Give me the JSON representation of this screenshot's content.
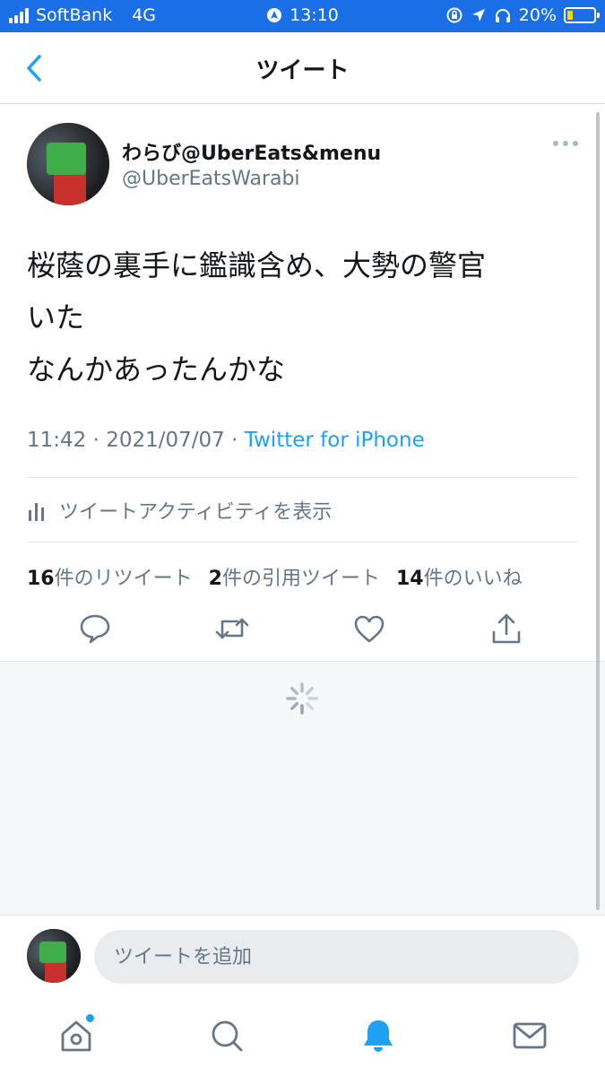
{
  "status_bar": {
    "carrier": "SoftBank",
    "network": "4G",
    "time": "13:10",
    "battery_percent": "20%",
    "battery_level": 0.2
  },
  "header": {
    "title": "ツイート",
    "back_icon": "chevron-left-icon"
  },
  "tweet": {
    "display_name": "わらび@UberEats&menu",
    "handle": "@UberEatsWarabi",
    "text": "桜蔭の裏手に鑑識含め、大勢の警官\nいた\nなんかあったんかな",
    "time": "11:42",
    "date": "2021/07/07",
    "separator": "·",
    "source": "Twitter for iPhone",
    "activity_label": "ツイートアクティビティを表示",
    "stats": {
      "retweets_count": "16",
      "retweets_label": "件のリツイート",
      "quotes_count": "2",
      "quotes_label": "件の引用ツイート",
      "likes_count": "14",
      "likes_label": "件のいいね"
    }
  },
  "compose": {
    "placeholder": "ツイートを追加"
  },
  "colors": {
    "status_bar": "#1a6ee6",
    "accent": "#1da1f2",
    "secondary_text": "#657786"
  }
}
